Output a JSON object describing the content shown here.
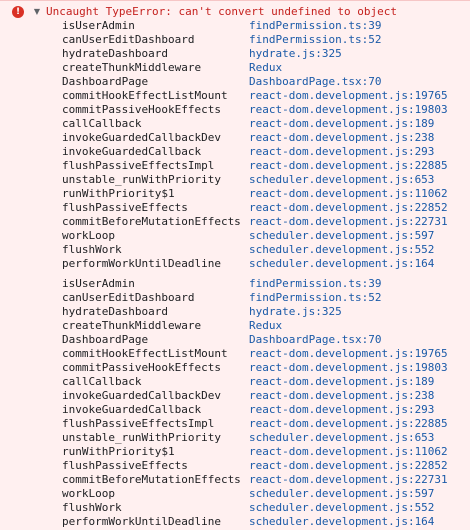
{
  "error": {
    "icon": "error-circle-icon",
    "icon_glyph": "!",
    "caret": "▼",
    "message": "Uncaught TypeError: can't convert undefined to object"
  },
  "colors": {
    "error_text": "#c5221f",
    "error_icon": "#d93025",
    "error_background": "#fff0f0",
    "link": "#1a5aa8"
  },
  "stack_a": [
    {
      "fn": "isUserAdmin",
      "src": "findPermission.ts:39"
    },
    {
      "fn": "canUserEditDashboard",
      "src": "findPermission.ts:52"
    },
    {
      "fn": "hydrateDashboard",
      "src": "hydrate.js:325"
    },
    {
      "fn": "createThunkMiddleware",
      "src": "Redux"
    },
    {
      "fn": "DashboardPage",
      "src": "DashboardPage.tsx:70"
    },
    {
      "fn": "commitHookEffectListMount",
      "src": "react-dom.development.js:19765"
    },
    {
      "fn": "commitPassiveHookEffects",
      "src": "react-dom.development.js:19803"
    },
    {
      "fn": "callCallback",
      "src": "react-dom.development.js:189"
    },
    {
      "fn": "invokeGuardedCallbackDev",
      "src": "react-dom.development.js:238"
    },
    {
      "fn": "invokeGuardedCallback",
      "src": "react-dom.development.js:293"
    },
    {
      "fn": "flushPassiveEffectsImpl",
      "src": "react-dom.development.js:22885"
    },
    {
      "fn": "unstable_runWithPriority",
      "src": "scheduler.development.js:653"
    },
    {
      "fn": "runWithPriority$1",
      "src": "react-dom.development.js:11062"
    },
    {
      "fn": "flushPassiveEffects",
      "src": "react-dom.development.js:22852"
    },
    {
      "fn": "commitBeforeMutationEffects",
      "src": "react-dom.development.js:22731"
    },
    {
      "fn": "workLoop",
      "src": "scheduler.development.js:597"
    },
    {
      "fn": "flushWork",
      "src": "scheduler.development.js:552"
    },
    {
      "fn": "performWorkUntilDeadline",
      "src": "scheduler.development.js:164"
    }
  ],
  "stack_b": [
    {
      "fn": "isUserAdmin",
      "src": "findPermission.ts:39"
    },
    {
      "fn": "canUserEditDashboard",
      "src": "findPermission.ts:52"
    },
    {
      "fn": "hydrateDashboard",
      "src": "hydrate.js:325"
    },
    {
      "fn": "createThunkMiddleware",
      "src": "Redux"
    },
    {
      "fn": "DashboardPage",
      "src": "DashboardPage.tsx:70"
    },
    {
      "fn": "commitHookEffectListMount",
      "src": "react-dom.development.js:19765"
    },
    {
      "fn": "commitPassiveHookEffects",
      "src": "react-dom.development.js:19803"
    },
    {
      "fn": "callCallback",
      "src": "react-dom.development.js:189"
    },
    {
      "fn": "invokeGuardedCallbackDev",
      "src": "react-dom.development.js:238"
    },
    {
      "fn": "invokeGuardedCallback",
      "src": "react-dom.development.js:293"
    },
    {
      "fn": "flushPassiveEffectsImpl",
      "src": "react-dom.development.js:22885"
    },
    {
      "fn": "unstable_runWithPriority",
      "src": "scheduler.development.js:653"
    },
    {
      "fn": "runWithPriority$1",
      "src": "react-dom.development.js:11062"
    },
    {
      "fn": "flushPassiveEffects",
      "src": "react-dom.development.js:22852"
    },
    {
      "fn": "commitBeforeMutationEffects",
      "src": "react-dom.development.js:22731"
    },
    {
      "fn": "workLoop",
      "src": "scheduler.development.js:597"
    },
    {
      "fn": "flushWork",
      "src": "scheduler.development.js:552"
    },
    {
      "fn": "performWorkUntilDeadline",
      "src": "scheduler.development.js:164"
    }
  ]
}
